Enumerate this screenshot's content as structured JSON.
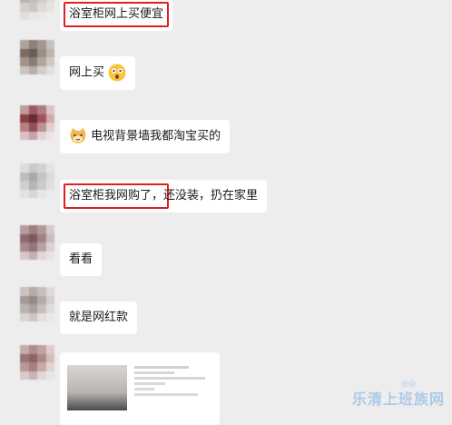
{
  "messages": [
    {
      "text": "浴室柜网上买便宜",
      "highlighted": true
    },
    {
      "text": "网上买",
      "emoji": "astonished-face-icon"
    },
    {
      "text": "电视背景墙我都淘宝买的",
      "emoji": "cat-face-icon"
    },
    {
      "text_highlight": "浴室柜我网购了，",
      "text_rest": "还没装，扔在家里"
    },
    {
      "text": "看看"
    },
    {
      "text": "就是网红款"
    }
  ],
  "watermark": "乐清上班族网",
  "colors": {
    "background": "#ededed",
    "bubble": "#ffffff",
    "highlight": "#e02020"
  }
}
